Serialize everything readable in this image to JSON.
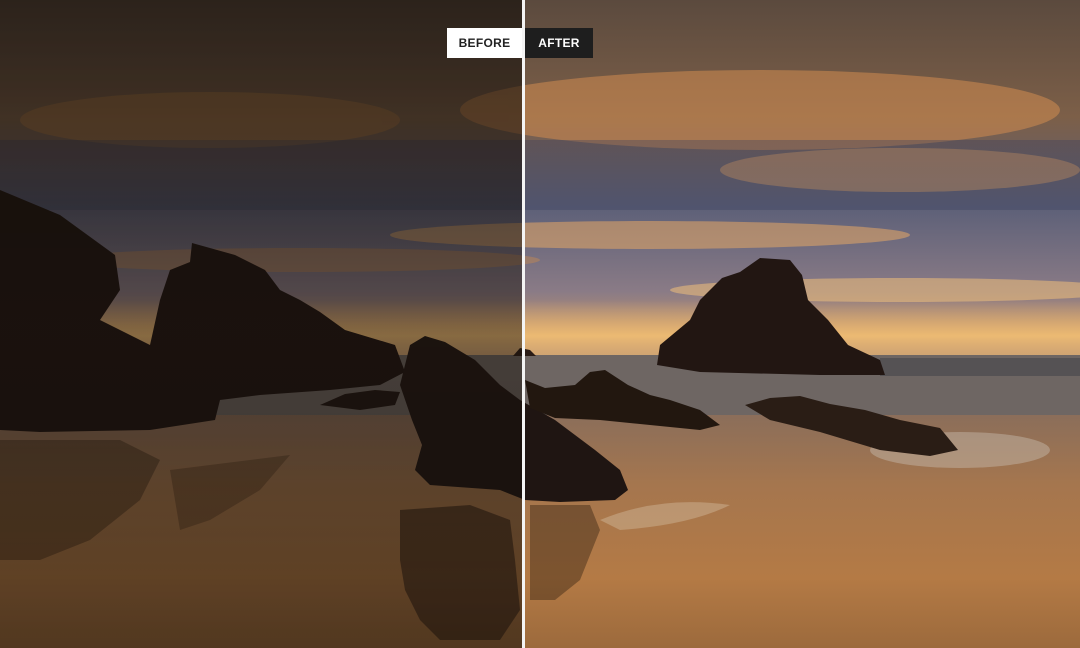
{
  "comparison": {
    "before_label": "BEFORE",
    "after_label": "AFTER"
  },
  "colors": {
    "divider": "#f4f4f4",
    "before_tag_bg": "#ffffff",
    "after_tag_bg": "#1e1e1e"
  }
}
